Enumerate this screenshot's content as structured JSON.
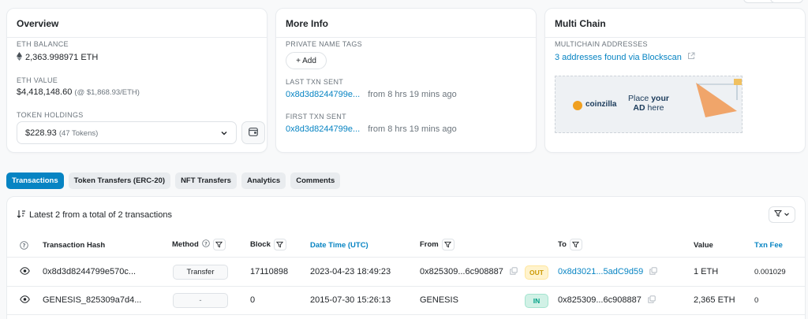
{
  "overview": {
    "title": "Overview",
    "eth_balance_label": "ETH BALANCE",
    "eth_balance": "2,363.998971 ETH",
    "eth_value_label": "ETH VALUE",
    "eth_value": "$4,418,148.60",
    "eth_rate": "(@ $1,868.93/ETH)",
    "token_holdings_label": "TOKEN HOLDINGS",
    "token_value": "$228.93",
    "token_count": "(47 Tokens)"
  },
  "more_info": {
    "title": "More Info",
    "private_tags_label": "PRIVATE NAME TAGS",
    "add_label": "+ Add",
    "last_txn_label": "LAST TXN SENT",
    "last_txn_hash": "0x8d3d8244799e...",
    "last_txn_time": "from 8 hrs 19 mins ago",
    "first_txn_label": "FIRST TXN SENT",
    "first_txn_hash": "0x8d3d8244799e...",
    "first_txn_time": "from 8 hrs 19 mins ago"
  },
  "multi_chain": {
    "title": "Multi Chain",
    "addresses_label": "MULTICHAIN ADDRESSES",
    "addresses_link": "3 addresses found via Blockscan",
    "ad_brand": "coinzilla",
    "ad_line1a": "Place ",
    "ad_line1b": "your",
    "ad_line2a": "AD",
    "ad_line2b": " here"
  },
  "tabs": [
    {
      "label": "Transactions",
      "active": true
    },
    {
      "label": "Token Transfers (ERC-20)",
      "active": false
    },
    {
      "label": "NFT Transfers",
      "active": false
    },
    {
      "label": "Analytics",
      "active": false
    },
    {
      "label": "Comments",
      "active": false
    }
  ],
  "table": {
    "summary": "Latest 2 from a total of 2 transactions",
    "headers": {
      "hash": "Transaction Hash",
      "method": "Method",
      "block": "Block",
      "datetime": "Date Time (UTC)",
      "from": "From",
      "to": "To",
      "value": "Value",
      "fee": "Txn Fee"
    },
    "rows": [
      {
        "hash": "0x8d3d8244799e570c...",
        "method": "Transfer",
        "block": "17110898",
        "datetime": "2023-04-23 18:49:23",
        "from": "0x825309...6c908887",
        "direction": "OUT",
        "to": "0x8d3021...5adC9d59",
        "value": "1 ETH",
        "fee": "0.001029"
      },
      {
        "hash": "GENESIS_825309a7d4...",
        "method": "-",
        "block": "0",
        "datetime": "2015-07-30 15:26:13",
        "from": "GENESIS",
        "direction": "IN",
        "to": "0x825309...6c908887",
        "value": "2,365 ETH",
        "fee": "0"
      }
    ]
  },
  "colors": {
    "accent": "#0784c3",
    "out_badge": "#cc9a06",
    "in_badge": "#00a186"
  }
}
